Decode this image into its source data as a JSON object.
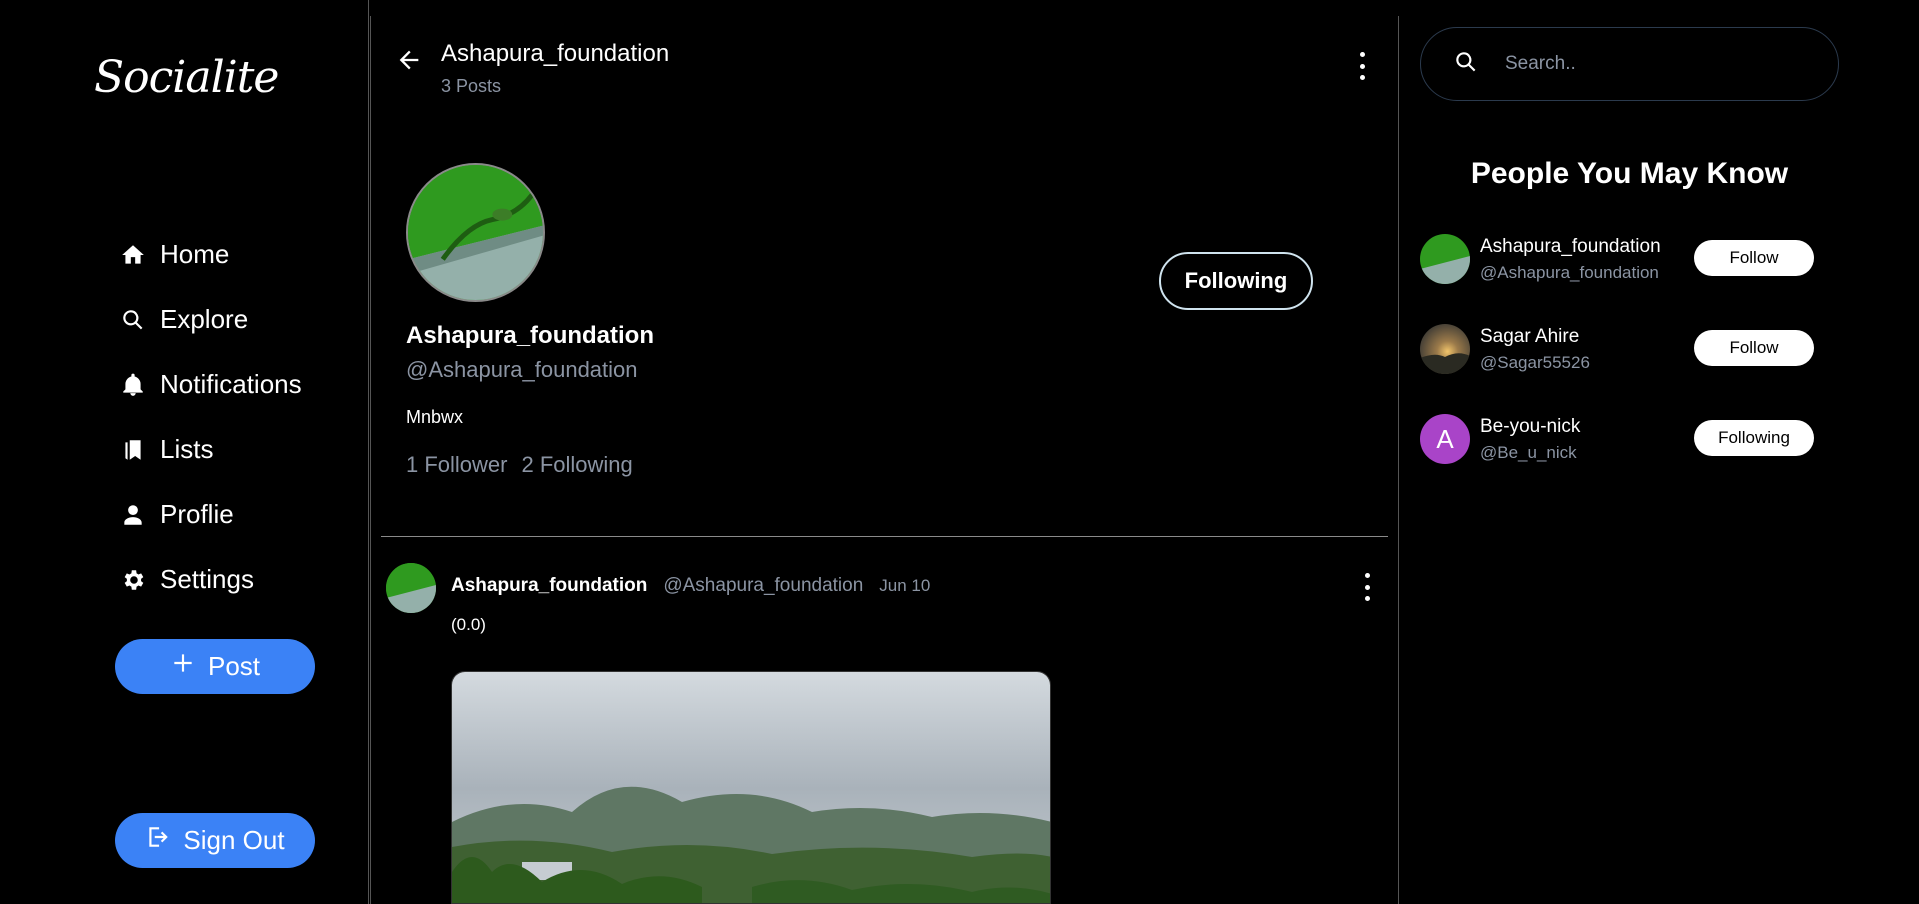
{
  "app": {
    "logo": "Socialite"
  },
  "sidebar": {
    "items": [
      {
        "label": "Home",
        "icon": "home-icon"
      },
      {
        "label": "Explore",
        "icon": "search-icon"
      },
      {
        "label": "Notifications",
        "icon": "bell-icon"
      },
      {
        "label": "Lists",
        "icon": "bookmark-icon"
      },
      {
        "label": "Proflie",
        "icon": "person-icon"
      },
      {
        "label": "Settings",
        "icon": "gear-icon"
      }
    ],
    "post_button": "Post",
    "signout_button": "Sign Out"
  },
  "header": {
    "title": "Ashapura_foundation",
    "subtitle": "3 Posts"
  },
  "profile": {
    "name": "Ashapura_foundation",
    "handle": "@Ashapura_foundation",
    "bio": "Mnbwx",
    "followers": "1 Follower",
    "following": "2 Following",
    "follow_state": "Following"
  },
  "post": {
    "author": "Ashapura_foundation",
    "handle": "@Ashapura_foundation",
    "date": "Jun 10",
    "text": "(0.0)"
  },
  "search": {
    "placeholder": "Search.."
  },
  "suggestions": {
    "title": "People You May Know",
    "people": [
      {
        "name": "Ashapura_foundation",
        "handle": "@Ashapura_foundation",
        "button": "Follow"
      },
      {
        "name": "Sagar Ahire",
        "handle": "@Sagar55526",
        "button": "Follow"
      },
      {
        "name": "Be-you-nick",
        "handle": "@Be_u_nick",
        "button": "Following",
        "initial": "A"
      }
    ]
  },
  "colors": {
    "accent": "#3b82f6",
    "background": "#000000",
    "muted_text": "#8b94a3",
    "initial_avatar": "#a944c8"
  }
}
